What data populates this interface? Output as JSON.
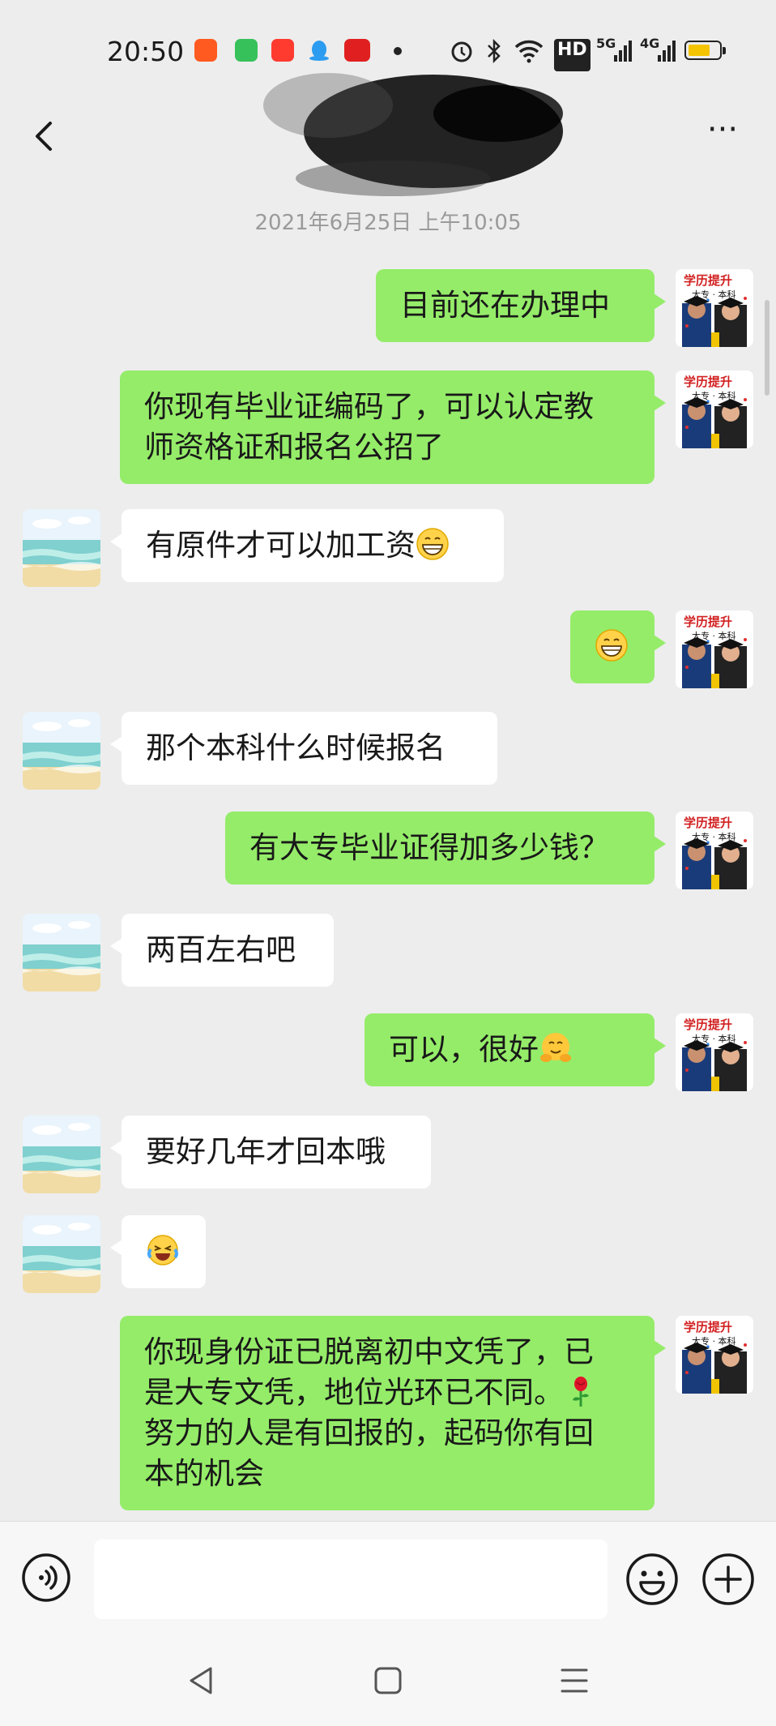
{
  "status_bar": {
    "time": "20:50",
    "badges": {
      "hd": "HD",
      "net1": "5G",
      "net2": "4G"
    },
    "colors": {
      "app1": "#ff5a1f",
      "app2": "#37c15a",
      "app3": "#ff3b30",
      "qq": "#2c9cf0",
      "news": "#e02020"
    },
    "icons": [
      "app-icon",
      "app-icon",
      "music-app-icon",
      "qq-icon",
      "news-app-icon",
      "alarm-icon",
      "bluetooth-icon",
      "wifi-icon",
      "hd-icon",
      "signal-5g-icon",
      "signal-4g-icon",
      "battery-icon"
    ]
  },
  "header": {
    "back_icon": "chevron-left-icon",
    "more_label": "···"
  },
  "chat": {
    "date": "2021年6月25日 上午10:05",
    "self_avatar_banner": "学历提升",
    "self_avatar_sub": "大专 · 本科",
    "messages": [
      {
        "side": "sent",
        "text": "目前还在办理中"
      },
      {
        "side": "sent",
        "text": "你现有毕业证编码了，可以认定教\n师资格证和报名公招了"
      },
      {
        "side": "recv",
        "text": "有原件才可以加工资",
        "emoji": "grin-icon"
      },
      {
        "side": "sent",
        "text": "",
        "emoji": "grin-icon"
      },
      {
        "side": "recv",
        "text": "那个本科什么时候报名"
      },
      {
        "side": "sent",
        "text": "有大专毕业证得加多少钱？"
      },
      {
        "side": "recv",
        "text": "两百左右吧"
      },
      {
        "side": "sent",
        "text": "可以，很好",
        "emoji": "hugging-face-icon"
      },
      {
        "side": "recv",
        "text": "要好几年才回本哦"
      },
      {
        "side": "recv",
        "text": "",
        "emoji": "laughing-tears-icon"
      },
      {
        "side": "sent",
        "text": "你现身份证已脱离初中文凭了，已\n是大专文凭，地位光环已不同。\n努力的人是有回报的，起码你有回\n本的机会",
        "emoji": "rose-icon"
      }
    ]
  },
  "input_bar": {
    "placeholder": "",
    "icons": [
      "voice-icon",
      "emoji-face-icon",
      "plus-icon"
    ]
  },
  "nav_bar": {
    "icons": [
      "back-triangle-icon",
      "home-square-icon",
      "menu-lines-icon"
    ]
  },
  "colors": {
    "sent_bubble": "#95ec69",
    "recv_bubble": "#ffffff",
    "background": "#ededed"
  }
}
